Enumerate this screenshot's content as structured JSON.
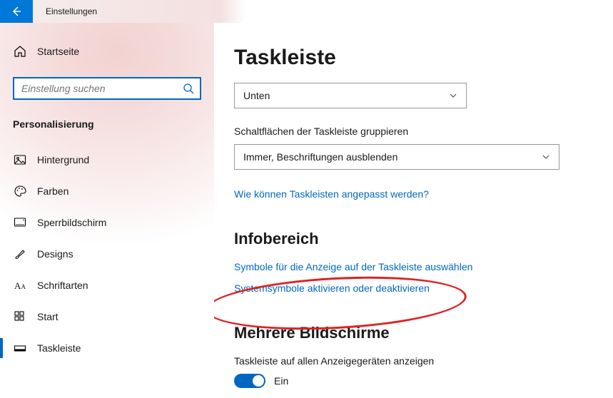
{
  "titlebar": {
    "title": "Einstellungen"
  },
  "sidebar": {
    "home_label": "Startseite",
    "search_placeholder": "Einstellung suchen",
    "section_header": "Personalisierung",
    "items": [
      {
        "label": "Hintergrund",
        "icon": "image-icon",
        "selected": false
      },
      {
        "label": "Farben",
        "icon": "palette-icon",
        "selected": false
      },
      {
        "label": "Sperrbildschirm",
        "icon": "lock-screen-icon",
        "selected": false
      },
      {
        "label": "Designs",
        "icon": "brush-icon",
        "selected": false
      },
      {
        "label": "Schriftarten",
        "icon": "font-icon",
        "selected": false
      },
      {
        "label": "Start",
        "icon": "start-icon",
        "selected": false
      },
      {
        "label": "Taskleiste",
        "icon": "taskbar-icon",
        "selected": true
      }
    ]
  },
  "main": {
    "page_title": "Taskleiste",
    "position_dropdown": {
      "value": "Unten"
    },
    "group_label": "Schaltflächen der Taskleiste gruppieren",
    "group_dropdown": {
      "value": "Immer, Beschriftungen ausblenden"
    },
    "customize_link": "Wie können Taskleisten angepasst werden?",
    "notification_section": {
      "title": "Infobereich",
      "link_symbols": "Symbole für die Anzeige auf der Taskleiste auswählen",
      "link_system_icons": "Systemsymbole aktivieren oder deaktivieren"
    },
    "multi_display_section": {
      "title": "Mehrere Bildschirme",
      "toggle_label": "Taskleiste auf allen Anzeigegeräten anzeigen",
      "toggle_state_text": "Ein",
      "toggle_on": true
    }
  }
}
